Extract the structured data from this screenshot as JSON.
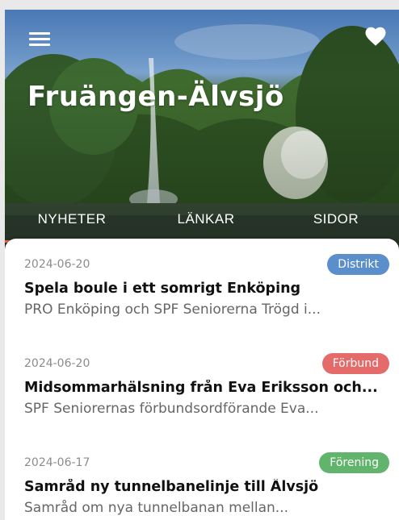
{
  "header": {
    "title": "Fruängen-Älvsjö",
    "menu_icon": "hamburger-menu-icon",
    "favorite_icon": "heart-icon"
  },
  "tabs": [
    {
      "label": "NYHETER",
      "active": true
    },
    {
      "label": "LÄNKAR",
      "active": false
    },
    {
      "label": "SIDOR",
      "active": false
    }
  ],
  "colors": {
    "accent": "#e8653d",
    "badge_distrikt": "#5b8fcc",
    "badge_forbund": "#e56b6b",
    "badge_forening": "#61b46b"
  },
  "news": [
    {
      "date": "2024-06-20",
      "category": "Distrikt",
      "title": "Spela boule i ett somrigt Enköping",
      "excerpt": "PRO Enköping och SPF Seniorerna Trögd i..."
    },
    {
      "date": "2024-06-20",
      "category": "Förbund",
      "title": "Midsommarhälsning från Eva Eriksson och...",
      "excerpt": "SPF Seniorernas förbundsordförande Eva..."
    },
    {
      "date": "2024-06-17",
      "category": "Förening",
      "title": "Samråd ny tunnelbanelinje till Älvsjö",
      "excerpt": "Samråd om nya tunnelbanan mellan..."
    }
  ]
}
